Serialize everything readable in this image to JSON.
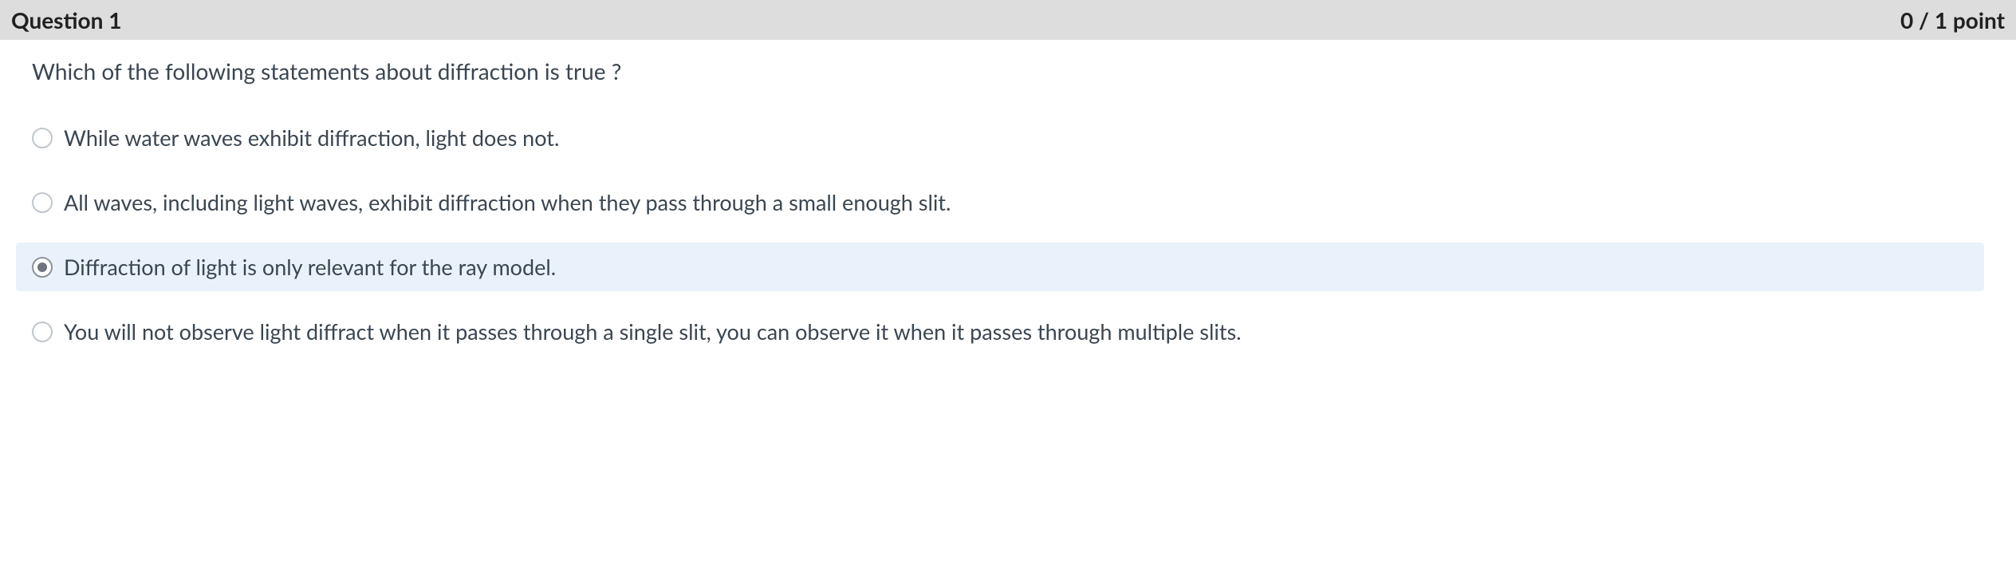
{
  "header": {
    "title": "Question 1",
    "points": "0 / 1 point"
  },
  "question_text": "Which of the following statements about diffraction is true ?",
  "options": [
    {
      "label": "While water waves exhibit diffraction, light does not.",
      "selected": false
    },
    {
      "label": "All waves, including light waves, exhibit diffraction when they pass through a small enough slit.",
      "selected": false
    },
    {
      "label": "Diffraction of light is only relevant for the ray model.",
      "selected": true
    },
    {
      "label": "You will not observe light diffract when it passes through a single slit, you can observe it when it passes through multiple slits.",
      "selected": false
    }
  ]
}
